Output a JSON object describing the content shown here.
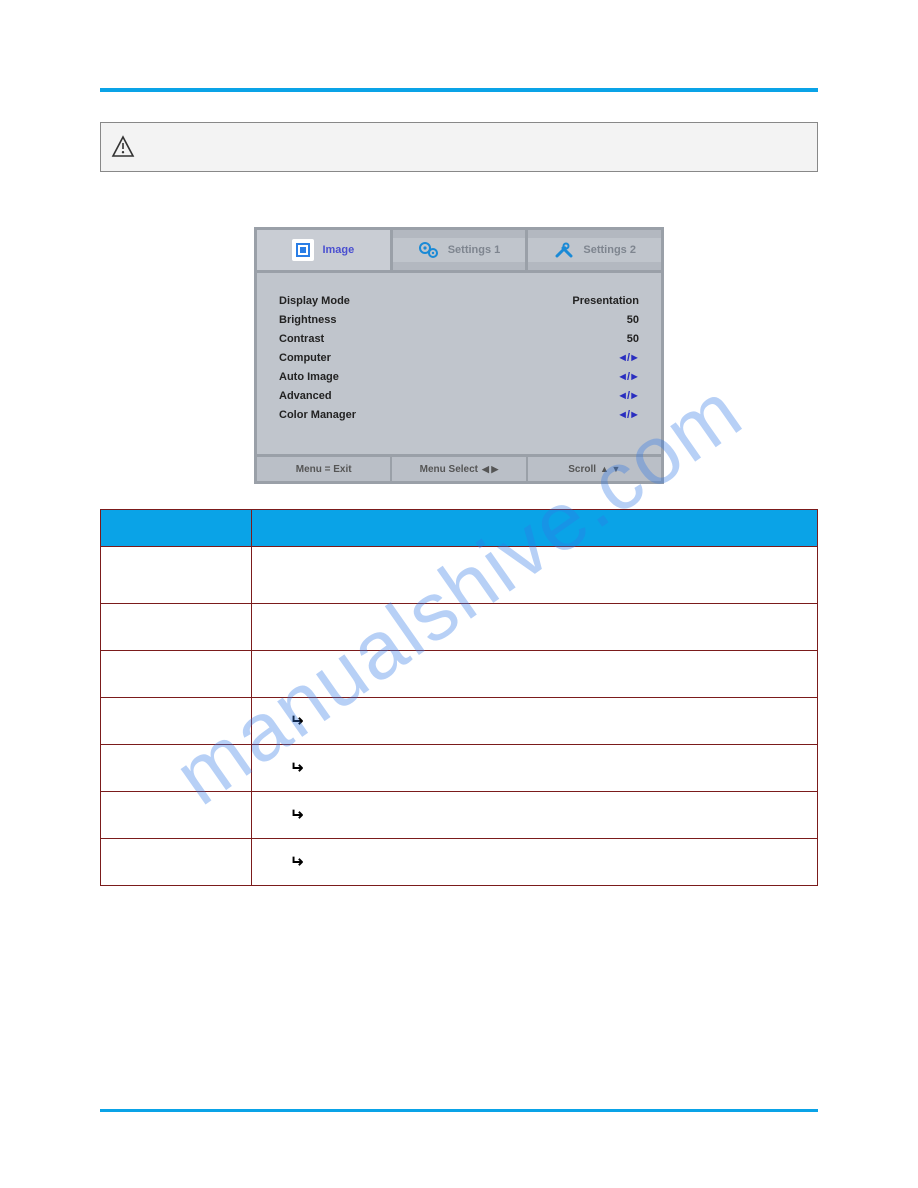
{
  "watermark": "manualshive.com",
  "osd": {
    "tabs": [
      {
        "label": "Image"
      },
      {
        "label": "Settings 1"
      },
      {
        "label": "Settings 2"
      }
    ],
    "rows": [
      {
        "label": "Display Mode",
        "value": "Presentation",
        "submenu": false
      },
      {
        "label": "Brightness",
        "value": "50",
        "submenu": false
      },
      {
        "label": "Contrast",
        "value": "50",
        "submenu": false
      },
      {
        "label": "Computer",
        "value": "◄/►",
        "submenu": true
      },
      {
        "label": "Auto Image",
        "value": "◄/►",
        "submenu": true
      },
      {
        "label": "Advanced",
        "value": "◄/►",
        "submenu": true
      },
      {
        "label": "Color Manager",
        "value": "◄/►",
        "submenu": true
      }
    ],
    "footer": {
      "exit": "Menu = Exit",
      "select": "Menu Select",
      "scroll": "Scroll"
    }
  },
  "table": {
    "headers": {
      "item": "",
      "desc": ""
    },
    "rows": [
      {
        "item": "",
        "desc": ""
      },
      {
        "item": "",
        "desc": ""
      },
      {
        "item": "",
        "desc": ""
      },
      {
        "item": "",
        "desc": "",
        "enter": true
      },
      {
        "item": "",
        "desc": "",
        "enter": true
      },
      {
        "item": "",
        "desc": "",
        "enter": true
      },
      {
        "item": "",
        "desc": "",
        "enter": true
      }
    ]
  }
}
